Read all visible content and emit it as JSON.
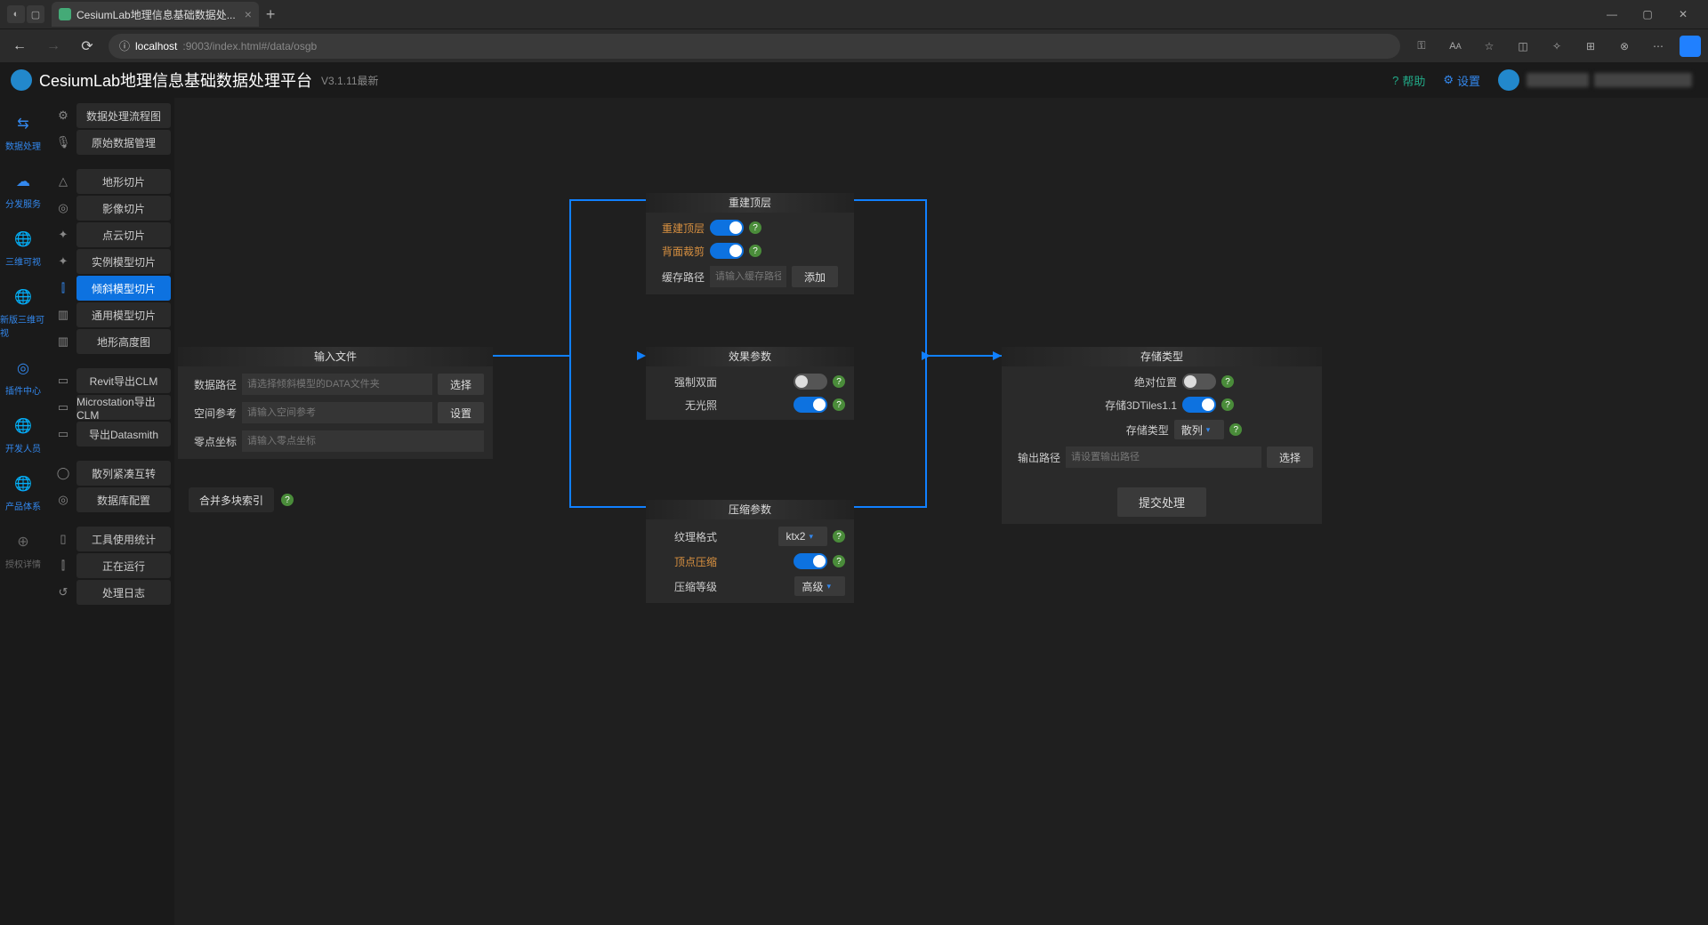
{
  "browser": {
    "tab_title": "CesiumLab地理信息基础数据处...",
    "url_host": "localhost",
    "url_path": ":9003/index.html#/data/osgb"
  },
  "header": {
    "title": "CesiumLab地理信息基础数据处理平台",
    "version": "V3.1.11最新",
    "help": "帮助",
    "settings": "设置"
  },
  "nav_rail": [
    {
      "label": "数据处理",
      "icon": "⇆"
    },
    {
      "label": "分发服务",
      "icon": "☁"
    },
    {
      "label": "三维可视",
      "icon": "🌐"
    },
    {
      "label": "新版三维可视",
      "icon": "🌐"
    },
    {
      "label": "插件中心",
      "icon": "◎"
    },
    {
      "label": "开发人员",
      "icon": "🌐"
    },
    {
      "label": "产品体系",
      "icon": "🌐"
    },
    {
      "label": "授权详情",
      "icon": "⊕",
      "dim": true
    }
  ],
  "submenu": {
    "groups": [
      [
        {
          "icon": "⚙",
          "label": "数据处理流程图"
        },
        {
          "icon": "🎙",
          "label": "原始数据管理"
        }
      ],
      [
        {
          "icon": "△",
          "label": "地形切片"
        },
        {
          "icon": "◎",
          "label": "影像切片"
        },
        {
          "icon": "✦",
          "label": "点云切片"
        },
        {
          "icon": "✦",
          "label": "实例模型切片"
        },
        {
          "icon": "⫿",
          "label": "倾斜模型切片",
          "active": true
        },
        {
          "icon": "▥",
          "label": "通用模型切片"
        },
        {
          "icon": "▥",
          "label": "地形高度图"
        }
      ],
      [
        {
          "icon": "▭",
          "label": "Revit导出CLM"
        },
        {
          "icon": "▭",
          "label": "Microstation导出CLM"
        },
        {
          "icon": "▭",
          "label": "导出Datasmith"
        }
      ],
      [
        {
          "icon": "◯",
          "label": "散列紧凑互转"
        },
        {
          "icon": "◎",
          "label": "数据库配置"
        }
      ],
      [
        {
          "icon": "▯",
          "label": "工具使用统计"
        },
        {
          "icon": "⫿",
          "label": "正在运行"
        },
        {
          "icon": "↺",
          "label": "处理日志"
        }
      ]
    ]
  },
  "panels": {
    "input": {
      "title": "输入文件",
      "data_path_label": "数据路径",
      "data_path_ph": "请选择倾斜模型的DATA文件夹",
      "select_btn": "选择",
      "srs_label": "空间参考",
      "srs_ph": "请输入空间参考",
      "set_btn": "设置",
      "origin_label": "零点坐标",
      "origin_ph": "请输入零点坐标",
      "merge_btn": "合并多块索引"
    },
    "rebuild": {
      "title": "重建顶层",
      "rebuild_label": "重建顶层",
      "cull_label": "背面裁剪",
      "cache_label": "缓存路径",
      "cache_ph": "请输入缓存路径",
      "add_btn": "添加"
    },
    "effect": {
      "title": "效果参数",
      "double_label": "强制双面",
      "nolight_label": "无光照"
    },
    "compress": {
      "title": "压缩参数",
      "tex_label": "纹理格式",
      "tex_value": "ktx2",
      "vert_label": "顶点压缩",
      "level_label": "压缩等级",
      "level_value": "高级"
    },
    "storage": {
      "title": "存储类型",
      "abs_label": "绝对位置",
      "tiles_label": "存储3DTiles1.1",
      "type_label": "存储类型",
      "type_value": "散列",
      "out_label": "输出路径",
      "out_ph": "请设置输出路径",
      "select_btn": "选择",
      "submit": "提交处理"
    }
  }
}
